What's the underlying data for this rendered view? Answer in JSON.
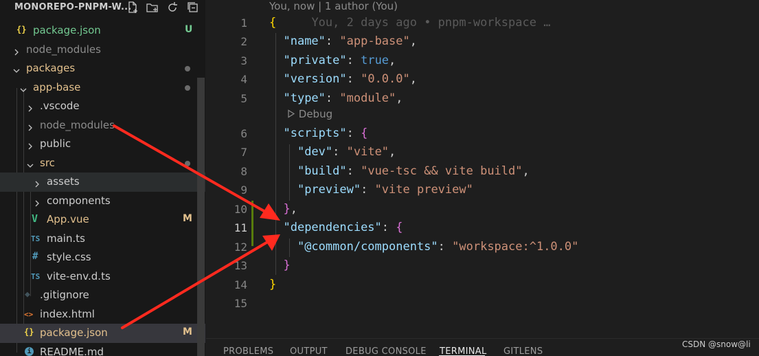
{
  "explorer": {
    "title": "MONOREPO-PNPM-W...",
    "actions": [
      "new-file-icon",
      "new-folder-icon",
      "refresh-icon",
      "collapse-all-icon"
    ]
  },
  "tree": [
    {
      "label": "package.json",
      "kind": "json",
      "icon_text": "{}",
      "badge": "U",
      "open": null
    },
    {
      "label": "node_modules",
      "kind": "folder",
      "open": false
    },
    {
      "label": "packages",
      "kind": "folder",
      "open": true,
      "dot": true
    },
    {
      "label": "app-base",
      "kind": "folder",
      "open": true,
      "dot": true
    },
    {
      "label": ".vscode",
      "kind": "folder",
      "open": false
    },
    {
      "label": "node_modules",
      "kind": "folder",
      "open": false
    },
    {
      "label": "public",
      "kind": "folder",
      "open": false
    },
    {
      "label": "src",
      "kind": "folder",
      "open": true,
      "dot": true
    },
    {
      "label": "assets",
      "kind": "folder",
      "open": false
    },
    {
      "label": "components",
      "kind": "folder",
      "open": false
    },
    {
      "label": "App.vue",
      "kind": "vue",
      "icon_text": "V",
      "badge": "M"
    },
    {
      "label": "main.ts",
      "kind": "ts",
      "icon_text": "TS"
    },
    {
      "label": "style.css",
      "kind": "css",
      "icon_text": "#"
    },
    {
      "label": "vite-env.d.ts",
      "kind": "ts",
      "icon_text": "TS"
    },
    {
      "label": ".gitignore",
      "kind": "git",
      "icon_text": "◆"
    },
    {
      "label": "index.html",
      "kind": "html",
      "icon_text": "<>"
    },
    {
      "label": "package.json",
      "kind": "json",
      "icon_text": "{}",
      "badge": "M"
    },
    {
      "label": "README.md",
      "kind": "info",
      "icon_text": "i"
    }
  ],
  "editor": {
    "codelens_top": "You, now | 1 author (You)",
    "blame_line1": "You, 2 days ago • pnpm-workspace …",
    "debug_lens": "Debug",
    "line_numbers": [
      "1",
      "2",
      "3",
      "4",
      "5",
      "6",
      "7",
      "8",
      "9",
      "10",
      "11",
      "12",
      "13",
      "14",
      "15"
    ],
    "lines": {
      "l1": "{",
      "l2_key": "\"name\"",
      "l2_val": "\"app-base\"",
      "l3_key": "\"private\"",
      "l3_val": "true",
      "l4_key": "\"version\"",
      "l4_val": "\"0.0.0\"",
      "l5_key": "\"type\"",
      "l5_val": "\"module\"",
      "l6_key": "\"scripts\"",
      "l6_open": "{",
      "l7_key": "\"dev\"",
      "l7_val": "\"vite\"",
      "l8_key": "\"build\"",
      "l8_val": "\"vue-tsc && vite build\"",
      "l9_key": "\"preview\"",
      "l9_val": "\"vite preview\"",
      "l10": "}",
      "l11_key": "\"dependencies\"",
      "l11_open": "{",
      "l12_key": "\"@common/components\"",
      "l12_val": "\"workspace:^1.0.0\"",
      "l13": "}",
      "l14": "}"
    }
  },
  "panel": {
    "tabs": [
      "PROBLEMS",
      "OUTPUT",
      "DEBUG CONSOLE",
      "TERMINAL",
      "GITLENS"
    ],
    "active_tab": "TERMINAL"
  },
  "watermark": "CSDN @snow@li",
  "colors": {
    "annotation_arrow": "#ff2a1f",
    "git_modified_bar": "#587c0c",
    "untracked": "#73c991",
    "modified": "#e2c08d"
  }
}
